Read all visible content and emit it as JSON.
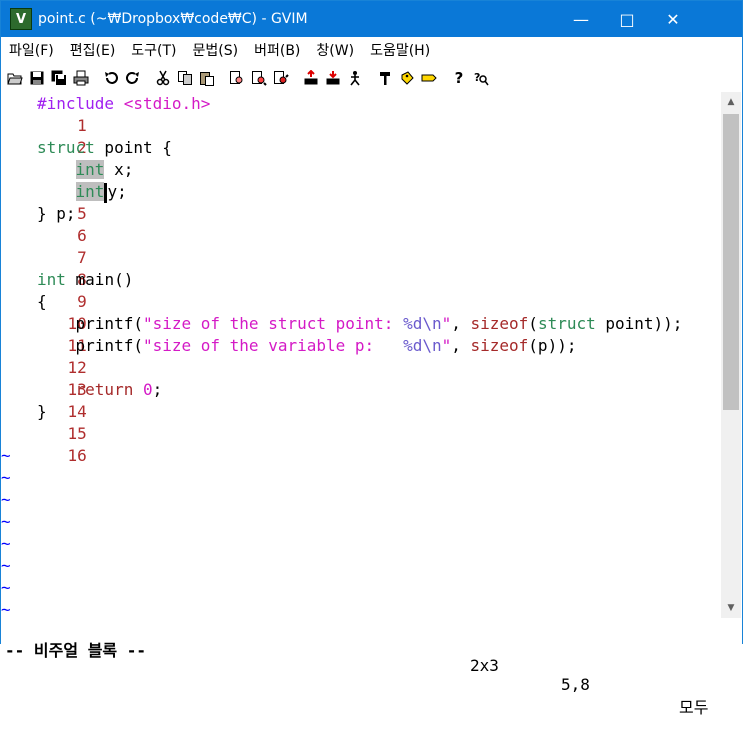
{
  "window": {
    "title": "point.c (~₩Dropbox₩code₩C) - GVIM",
    "icon_name": "vim-icon",
    "controls": {
      "minimize": "—",
      "maximize": "□",
      "close": "✕"
    }
  },
  "menubar": {
    "items": [
      "파일(F)",
      "편집(E)",
      "도구(T)",
      "문법(S)",
      "버퍼(B)",
      "창(W)",
      "도움말(H)"
    ]
  },
  "toolbar": {
    "buttons": [
      "open-icon",
      "save-icon",
      "save-all-icon",
      "print-icon",
      "undo-icon",
      "redo-icon",
      "cut-icon",
      "copy-icon",
      "paste-icon",
      "find-replace-icon",
      "find-next-icon",
      "find-prev-icon",
      "load-session-icon",
      "save-session-icon",
      "run-script-icon",
      "make-icon",
      "run-ctags-icon",
      "jump-tag-icon",
      "help-icon",
      "find-help-icon"
    ]
  },
  "editor": {
    "lines": [
      {
        "n": "1",
        "text": "#include <stdio.h>"
      },
      {
        "n": "2",
        "text": ""
      },
      {
        "n": "3",
        "text": "struct point {"
      },
      {
        "n": "4",
        "text": "    int x;"
      },
      {
        "n": "5",
        "text": "    int y;"
      },
      {
        "n": "6",
        "text": "} p;"
      },
      {
        "n": "7",
        "text": ""
      },
      {
        "n": "8",
        "text": ""
      },
      {
        "n": "9",
        "text": "int main()"
      },
      {
        "n": "10",
        "text": "{"
      },
      {
        "n": "11",
        "text": "    printf(\"size of the struct point: %d\\n\", sizeof(struct point));"
      },
      {
        "n": "12",
        "text": "    printf(\"size of the variable p:   %d\\n\", sizeof(p));"
      },
      {
        "n": "13",
        "text": ""
      },
      {
        "n": "14",
        "text": "    return 0;"
      },
      {
        "n": "15",
        "text": "}"
      },
      {
        "n": "16",
        "text": ""
      }
    ],
    "tilde": "~"
  },
  "status": {
    "mode": "-- 비주얼 블록 --",
    "selection": "2x3",
    "cursor": "5,8",
    "scroll": "모두"
  },
  "colors": {
    "titlebar": "#0a78d7",
    "line_number": "#af2d2d",
    "preproc": "#a020f0",
    "string": "#d41ac6",
    "type": "#2e8b57",
    "statement": "#a52a2a",
    "tilde": "#0000ff",
    "selection": "#bebebe"
  }
}
